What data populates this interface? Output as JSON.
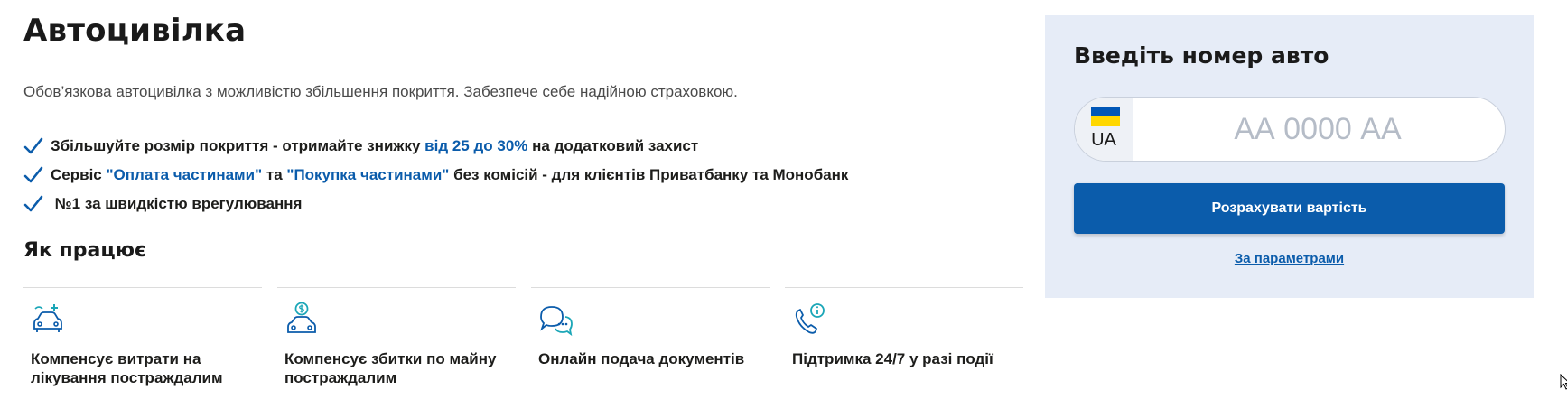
{
  "page": {
    "title": "Автоцивілка",
    "subtitle": "Обов’язкова автоцивілка з можливістю збільшення покриття. Забезпече себе надійною страховкою."
  },
  "benefits": [
    {
      "parts": [
        {
          "text": "Збільшуйте розмір покриття - отримайте знижку ",
          "highlight": false
        },
        {
          "text": "від 25 до 30%",
          "highlight": true
        },
        {
          "text": " на додатковий захист",
          "highlight": false
        }
      ]
    },
    {
      "parts": [
        {
          "text": "Сервіс ",
          "highlight": false
        },
        {
          "text": "\"Оплата частинами\"",
          "highlight": true
        },
        {
          "text": " та ",
          "highlight": false
        },
        {
          "text": "\"Покупка частинами\"",
          "highlight": true
        },
        {
          "text": " без комісій - для клієнтів Приватбанку та Монобанк",
          "highlight": false
        }
      ]
    },
    {
      "parts": [
        {
          "text": " №1 за швидкістю врегулювання",
          "highlight": false
        }
      ]
    }
  ],
  "how_it_works": {
    "title": "Як працює",
    "features": [
      {
        "icon": "car-medical-icon",
        "label": "Компенсує витрати на лікування постраждалим"
      },
      {
        "icon": "car-money-icon",
        "label": "Компенсує збитки по майну постраждалим"
      },
      {
        "icon": "chat-bubbles-icon",
        "label": "Онлайн подача документів"
      },
      {
        "icon": "phone-info-icon",
        "label": "Підтримка 24/7 у разі події"
      }
    ]
  },
  "calculator": {
    "title": "Введіть номер авто",
    "country_code": "UA",
    "plate_placeholder": "АА 0000 АА",
    "plate_value": "",
    "calc_button_label": "Розрахувати вартість",
    "params_link_label": "За параметрами"
  },
  "colors": {
    "accent": "#0b5cab",
    "panel_bg": "#e6ecf7",
    "icon_teal": "#1aa6b7",
    "flag_blue": "#0057b7",
    "flag_yellow": "#ffd700"
  }
}
